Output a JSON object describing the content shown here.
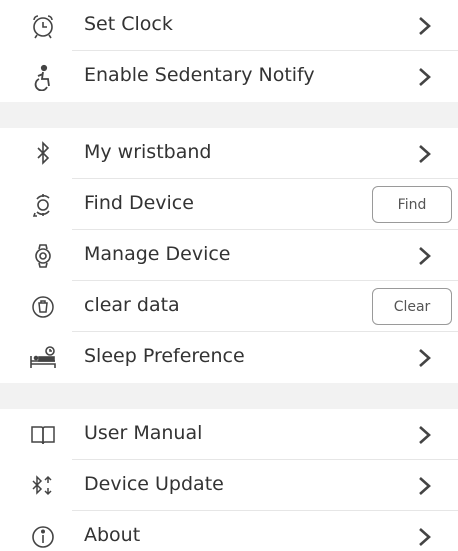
{
  "settings": {
    "items": [
      {
        "label": "Set Clock",
        "icon": "alarm-clock-icon",
        "action": "chevron"
      },
      {
        "label": "Enable Sedentary Notify",
        "icon": "sedentary-person-icon",
        "action": "chevron"
      },
      {
        "label": "My wristband",
        "icon": "bluetooth-icon",
        "action": "chevron"
      },
      {
        "label": "Find Device",
        "icon": "find-device-icon",
        "action": "button",
        "button_label": "Find"
      },
      {
        "label": "Manage Device",
        "icon": "watch-icon",
        "action": "chevron"
      },
      {
        "label": "clear data",
        "icon": "clear-data-icon",
        "action": "button",
        "button_label": "Clear"
      },
      {
        "label": "Sleep Preference",
        "icon": "bed-icon",
        "action": "chevron"
      },
      {
        "label": "User Manual",
        "icon": "book-icon",
        "action": "chevron"
      },
      {
        "label": "Device Update",
        "icon": "bluetooth-update-icon",
        "action": "chevron"
      },
      {
        "label": "About",
        "icon": "info-icon",
        "action": "chevron"
      }
    ]
  },
  "colors": {
    "text": "#333333",
    "divider": "#e6e6e6",
    "section_gap": "#f2f2f2",
    "icon": "#444444"
  }
}
